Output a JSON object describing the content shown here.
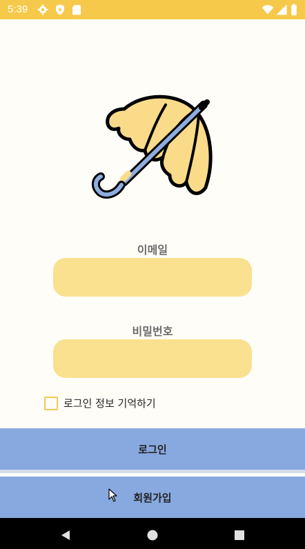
{
  "status_bar": {
    "time": "5:39",
    "left_icons": [
      "gear-icon",
      "play-protect-icon",
      "sd-card-icon"
    ],
    "right_icons": [
      "wifi-icon",
      "signal-icon",
      "battery-icon"
    ],
    "color": "#f6c94b"
  },
  "logo": {
    "icon": "umbrella-icon"
  },
  "form": {
    "email": {
      "label": "이메일",
      "value": "",
      "placeholder": ""
    },
    "password": {
      "label": "비밀번호",
      "value": "",
      "placeholder": ""
    },
    "remember": {
      "label": "로그인 정보 기억하기",
      "checked": false
    }
  },
  "buttons": {
    "login": "로그인",
    "signup": "회원가입"
  },
  "colors": {
    "input_bg": "#fae18f",
    "button_bg": "#88a9df",
    "background": "#fffdf8"
  },
  "nav_bar": {
    "buttons": [
      "back-icon",
      "home-icon",
      "recents-icon"
    ]
  }
}
